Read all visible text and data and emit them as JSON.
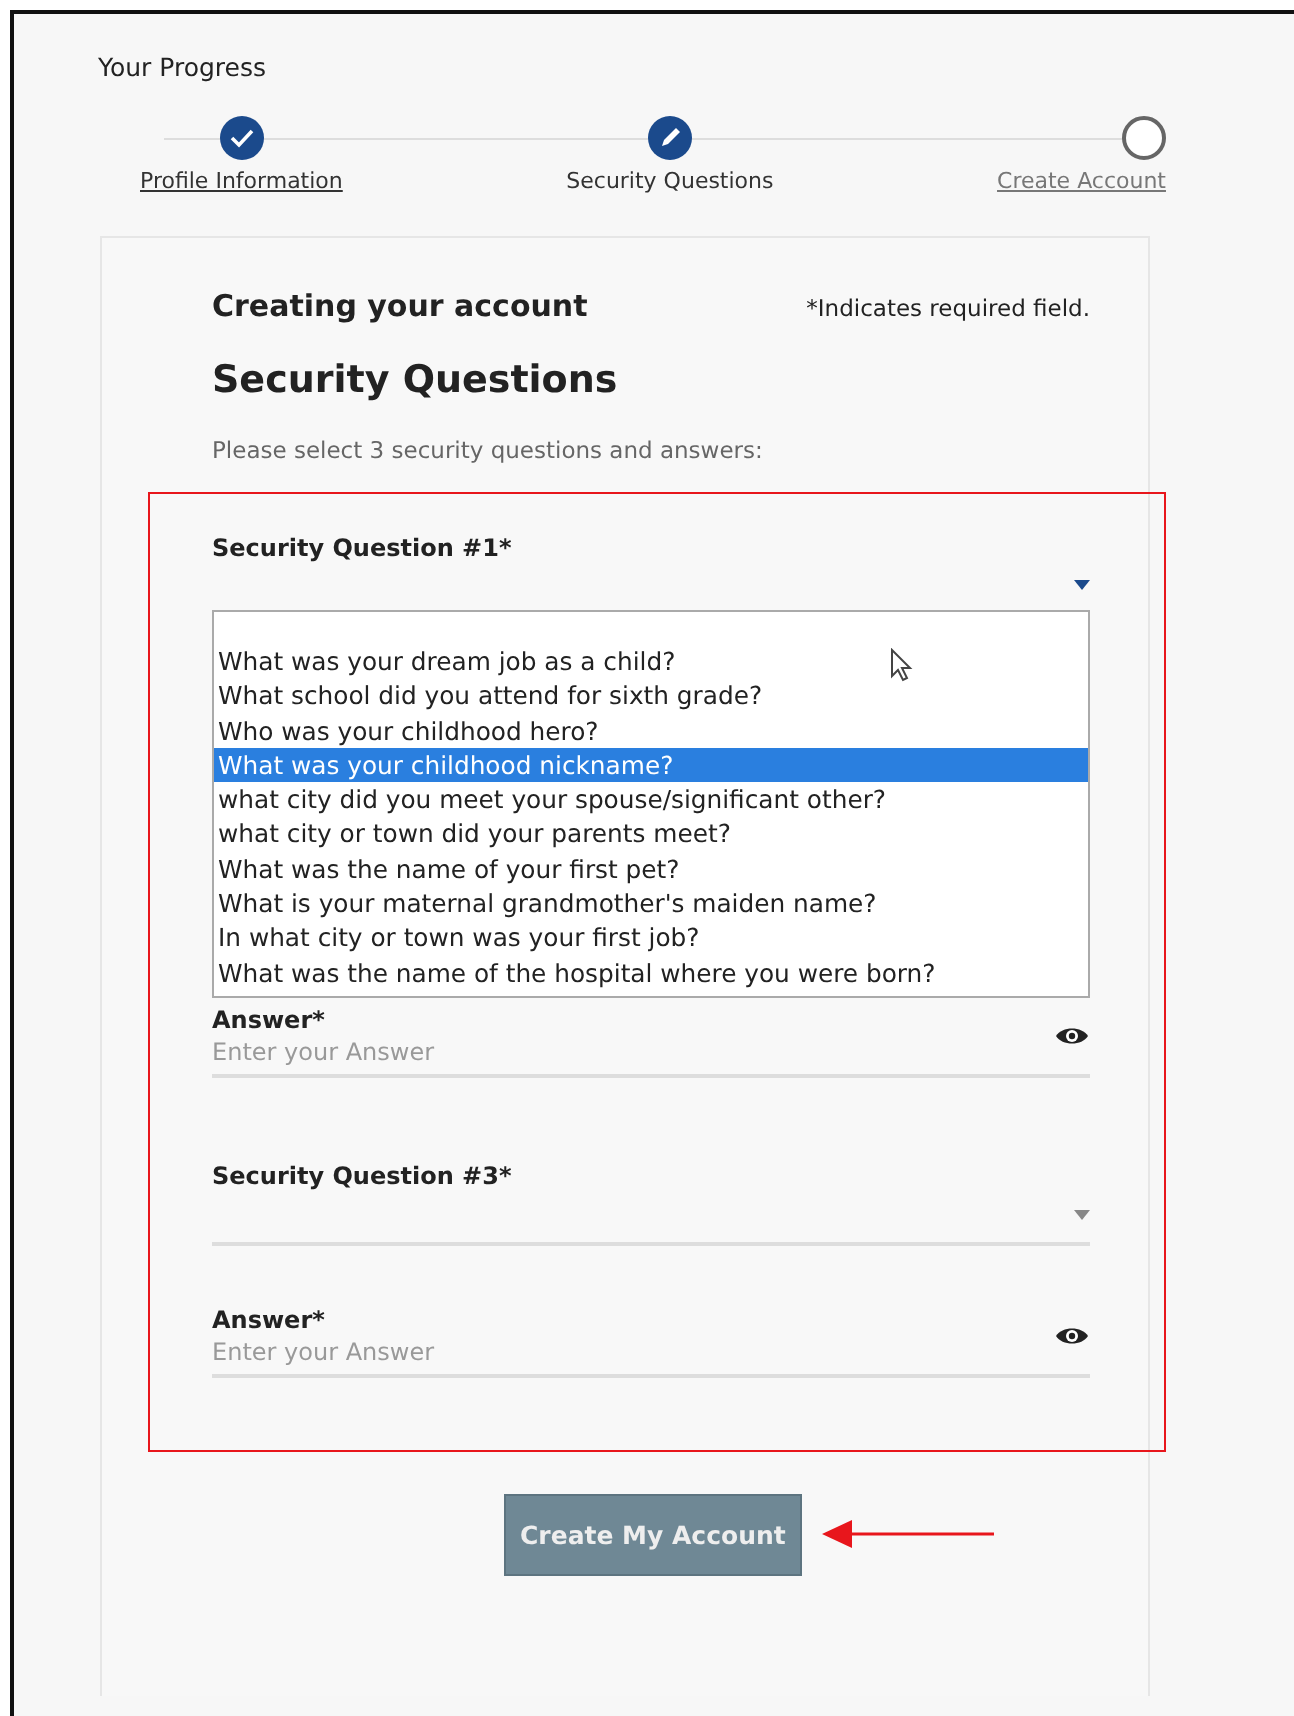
{
  "progress": {
    "title": "Your Progress",
    "steps": [
      {
        "label": "Profile Information",
        "completed": true,
        "current": false
      },
      {
        "label": "Security Questions",
        "completed": false,
        "current": true
      },
      {
        "label": "Create Account",
        "completed": false,
        "current": false
      }
    ]
  },
  "form": {
    "heading": "Creating your account",
    "required_note": "*Indicates required field.",
    "title": "Security Questions",
    "instruction": "Please select 3 security questions and answers:",
    "fields": [
      {
        "kind": "select",
        "label": "Security Question #1*",
        "open": true,
        "options": [
          {
            "text": "What was your dream job as a child?",
            "selected": false
          },
          {
            "text": "What school did you attend for sixth grade?",
            "selected": false
          },
          {
            "text": "Who was your childhood hero?",
            "selected": false
          },
          {
            "text": "What was your childhood nickname?",
            "selected": true
          },
          {
            "text": "what city did you meet your spouse/significant other?",
            "selected": false
          },
          {
            "text": "what city or town did your parents meet?",
            "selected": false
          },
          {
            "text": "What was the name of your first pet?",
            "selected": false
          },
          {
            "text": "What is your maternal grandmother's maiden name?",
            "selected": false
          },
          {
            "text": "In what city or town was your first job?",
            "selected": false
          },
          {
            "text": "What was the name of the hospital where you were born?",
            "selected": false
          }
        ]
      },
      {
        "kind": "answer",
        "label": "Answer*",
        "placeholder": "Enter your Answer"
      },
      {
        "kind": "select",
        "label": "Security Question #3*",
        "open": false
      },
      {
        "kind": "answer",
        "label": "Answer*",
        "placeholder": "Enter your Answer"
      }
    ],
    "submit": "Create My Account"
  }
}
